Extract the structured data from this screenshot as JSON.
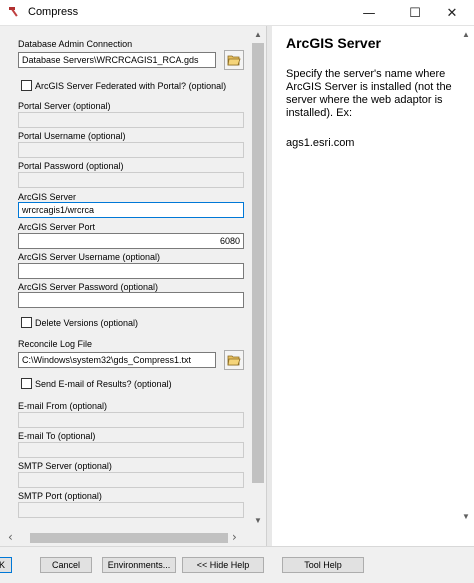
{
  "window": {
    "title": "Compress",
    "minimize": "—",
    "maximize": "☐",
    "close": "✕"
  },
  "form": {
    "db_admin_label": "Database Admin Connection",
    "db_admin_value": "Database Servers\\WRCRCAGIS1_RCA.gds",
    "federated_label": "ArcGIS Server Federated with Portal? (optional)",
    "federated_checked": false,
    "portal_server_label": "Portal Server (optional)",
    "portal_server_value": "",
    "portal_username_label": "Portal Username (optional)",
    "portal_username_value": "",
    "portal_password_label": "Portal Password (optional)",
    "portal_password_value": "",
    "arcgis_server_label": "ArcGIS Server",
    "arcgis_server_value": "wrcrcagis1/wrcrca",
    "arcgis_port_label": "ArcGIS Server Port",
    "arcgis_port_value": "6080",
    "arcgis_username_label": "ArcGIS Server Username (optional)",
    "arcgis_username_value": "",
    "arcgis_password_label": "ArcGIS Server Password (optional)",
    "arcgis_password_value": "",
    "delete_versions_label": "Delete Versions (optional)",
    "delete_versions_checked": false,
    "reconcile_log_label": "Reconcile Log File",
    "reconcile_log_value": "C:\\Windows\\system32\\gds_Compress1.txt",
    "send_email_label": "Send E-mail of Results? (optional)",
    "send_email_checked": false,
    "email_from_label": "E-mail From (optional)",
    "email_from_value": "",
    "email_to_label": "E-mail To (optional)",
    "email_to_value": "",
    "smtp_server_label": "SMTP Server (optional)",
    "smtp_server_value": "",
    "smtp_port_label": "SMTP Port (optional)",
    "smtp_port_value": ""
  },
  "scrollbar": {
    "up": "▲",
    "down": "▼",
    "left": "‹",
    "right": "›"
  },
  "help": {
    "title": "ArcGIS Server",
    "body": "Specify the server's name where ArcGIS Server is installed (not the server where the web adaptor is installed). Ex:",
    "example": "ags1.esri.com"
  },
  "buttons": {
    "ok": "K",
    "cancel": "Cancel",
    "environments": "Environments...",
    "hide_help": "<< Hide Help",
    "tool_help": "Tool Help"
  }
}
